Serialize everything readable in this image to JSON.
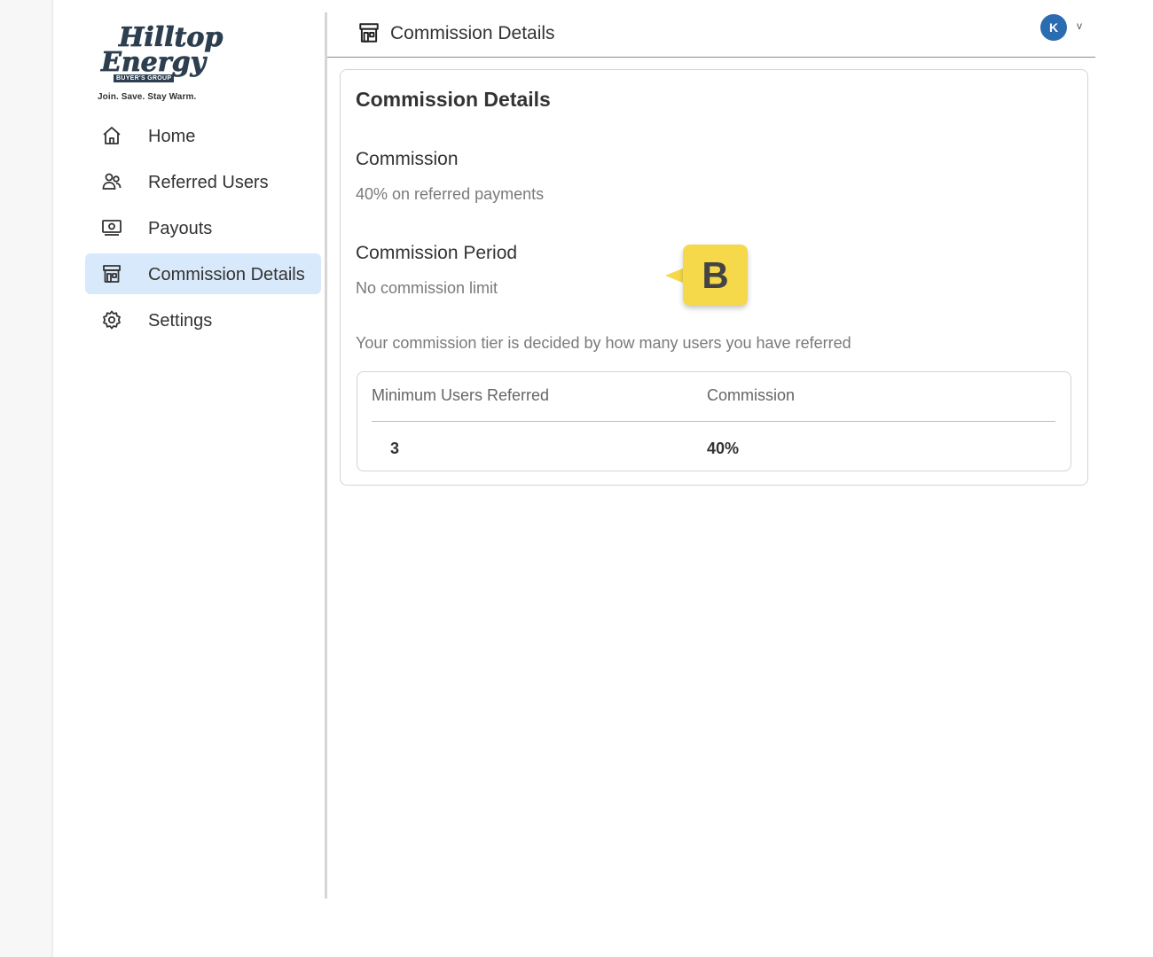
{
  "brand": {
    "logo_line1": "Hilltop",
    "logo_line2": "Energy",
    "logo_badge": "BUYER'S GROUP",
    "tagline": "Join. Save. Stay Warm."
  },
  "sidebar": {
    "items": [
      {
        "label": "Home",
        "icon": "home-icon",
        "active": false
      },
      {
        "label": "Referred Users",
        "icon": "users-icon",
        "active": false
      },
      {
        "label": "Payouts",
        "icon": "money-icon",
        "active": false
      },
      {
        "label": "Commission Details",
        "icon": "storefront-icon",
        "active": true
      },
      {
        "label": "Settings",
        "icon": "gear-icon",
        "active": false
      }
    ]
  },
  "header": {
    "title": "Commission Details",
    "icon": "storefront-icon",
    "avatar_initial": "K",
    "chevron": "v"
  },
  "main": {
    "card_title": "Commission Details",
    "commission_label": "Commission",
    "commission_value": "40% on referred payments",
    "period_label": "Commission Period",
    "period_value": "No commission limit",
    "tier_note": "Your commission tier is decided by how many users you have referred",
    "table": {
      "headers": [
        "Minimum Users Referred",
        "Commission"
      ],
      "rows": [
        [
          "3",
          "40%"
        ]
      ]
    }
  },
  "marker": {
    "label": "B"
  },
  "colors": {
    "accent": "#2b6cb0",
    "active_nav_bg": "#d8e9fb",
    "marker": "#f5d94a",
    "logo": "#2c3e50"
  }
}
